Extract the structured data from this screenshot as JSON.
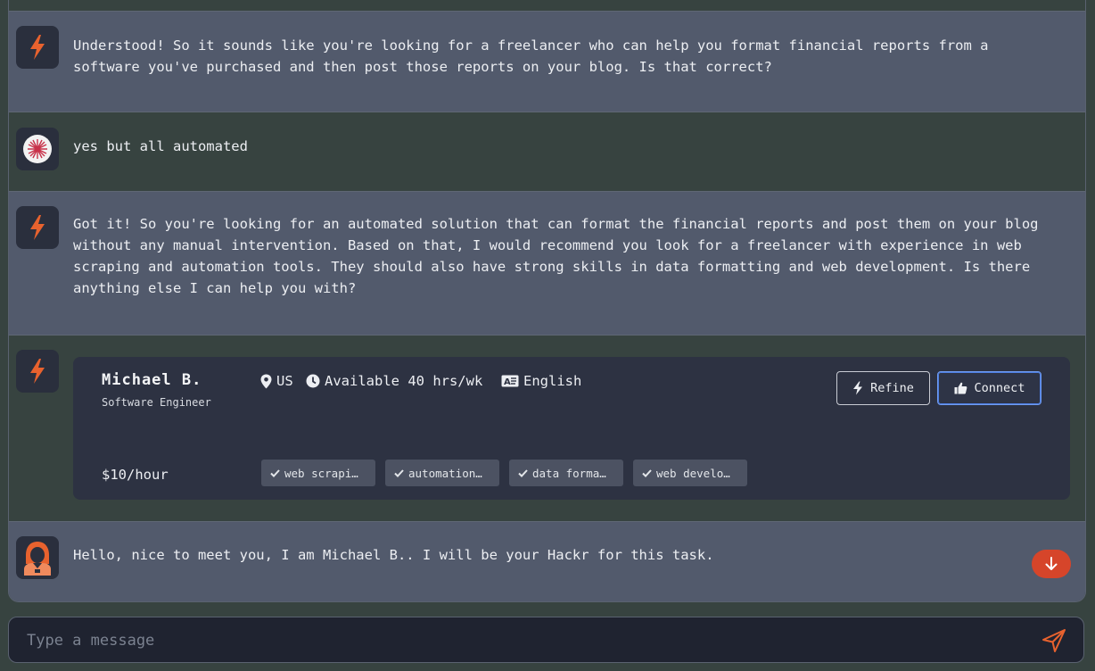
{
  "messages": {
    "m1": "Understood! So it sounds like you're looking for a freelancer who can help you format financial reports from a\nsoftware you've purchased and then post those reports on your blog. Is that correct?",
    "m2": "yes but all automated",
    "m3": "Got it! So you're looking for an automated solution that can format the financial reports and post them on your blog\nwithout any manual intervention. Based on that, I would recommend you look for a freelancer with experience in web\nscraping and automation tools. They should also have strong skills in data formatting and web development. Is there\nanything else I can help you with?",
    "m5": "Hello, nice to meet you, I am Michael B.. I will be your Hackr for this task."
  },
  "freelancer": {
    "name": "Michael B.",
    "title": "Software Engineer",
    "country": "US",
    "availability": "Available 40 hrs/wk",
    "language": "English",
    "rate": "$10/hour",
    "skills": [
      "web scrapi…",
      "automation…",
      "data forma…",
      "web develo…"
    ],
    "refine_label": "Refine",
    "connect_label": "Connect"
  },
  "composer": {
    "placeholder": "Type a message"
  },
  "colors": {
    "accent": "#e8622e",
    "scroll_button": "#d6452a",
    "bot_bg": "#525a6c",
    "user_bg": "#374340",
    "card_bg": "#2d3242"
  },
  "icons": [
    "bolt-icon",
    "user-avatar-icon",
    "map-pin-icon",
    "clock-icon",
    "language-icon",
    "thumbs-up-icon",
    "check-icon",
    "arrow-down-icon",
    "send-icon",
    "hacker-avatar-icon"
  ]
}
